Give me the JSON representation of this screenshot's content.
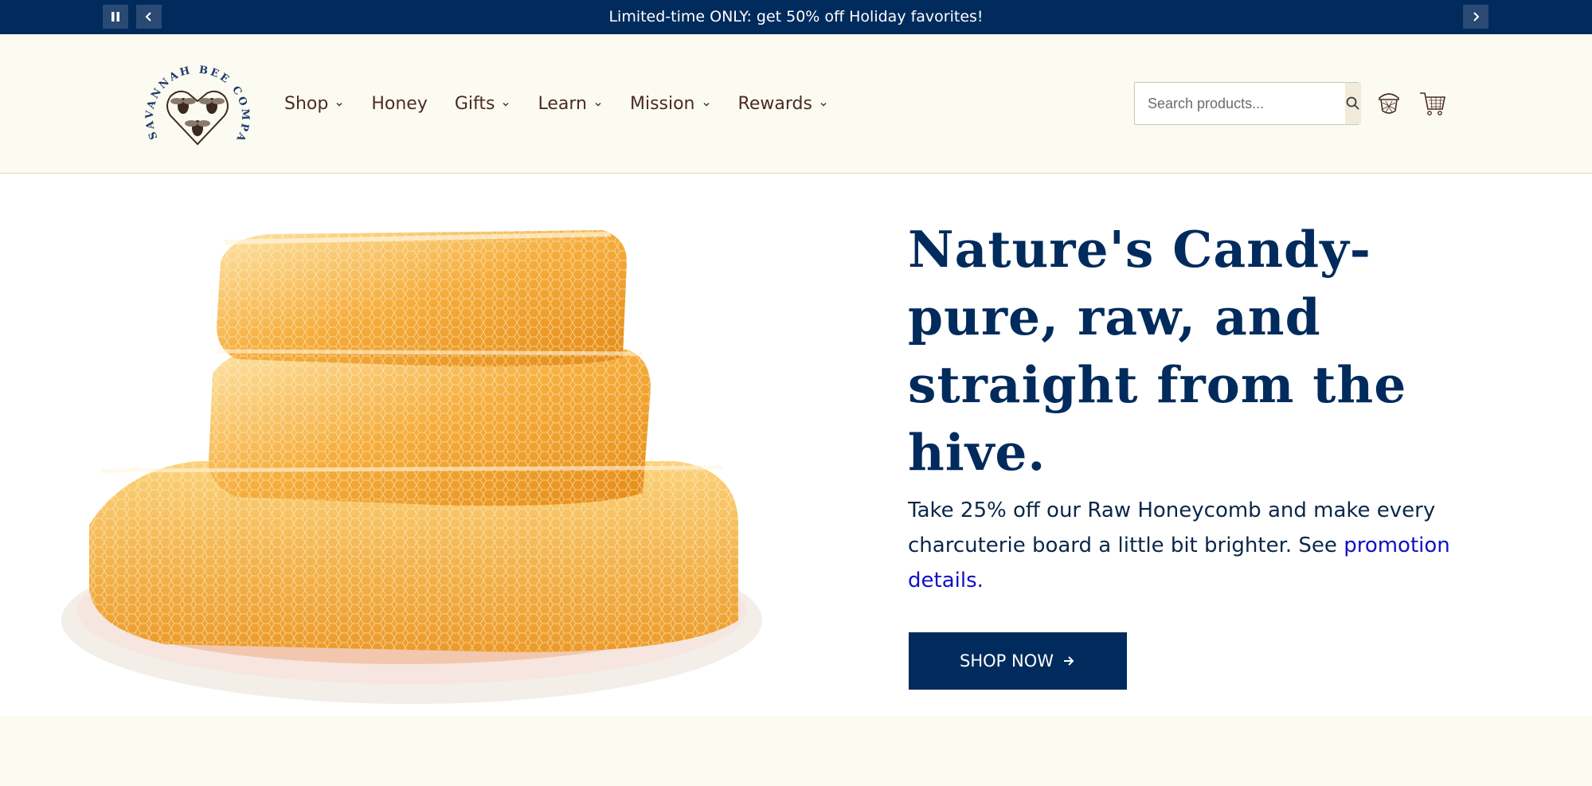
{
  "announcement": {
    "message": "Limited-time ONLY: get 50% off Holiday favorites!",
    "pause_icon": "pause-icon",
    "prev_icon": "chevron-left-icon",
    "next_icon": "chevron-right-icon"
  },
  "header": {
    "logo_text": "SAVANNAH BEE COMPANY",
    "nav": [
      {
        "label": "Shop",
        "has_dropdown": true
      },
      {
        "label": "Honey",
        "has_dropdown": false
      },
      {
        "label": "Gifts",
        "has_dropdown": true
      },
      {
        "label": "Learn",
        "has_dropdown": true
      },
      {
        "label": "Mission",
        "has_dropdown": true
      },
      {
        "label": "Rewards",
        "has_dropdown": true
      }
    ],
    "search": {
      "placeholder": "Search products...",
      "value": ""
    },
    "icons": [
      "search-icon",
      "beekeeper-account-icon",
      "cart-icon"
    ]
  },
  "hero": {
    "headline": "Nature's Candy-pure, raw, and straight from the hive.",
    "sub_text": "Take 25% off our Raw Honeycomb and make every charcuterie board a little bit brighter. See ",
    "sub_link": "promotion details.",
    "cta_label": "SHOP NOW",
    "cta_icon": "arrow-right-icon"
  },
  "colors": {
    "navy": "#002b5c",
    "cream": "#fcfbf2",
    "brown_text": "#4a2c22",
    "link_blue": "#1010c8",
    "honey": "#f2a93b"
  }
}
